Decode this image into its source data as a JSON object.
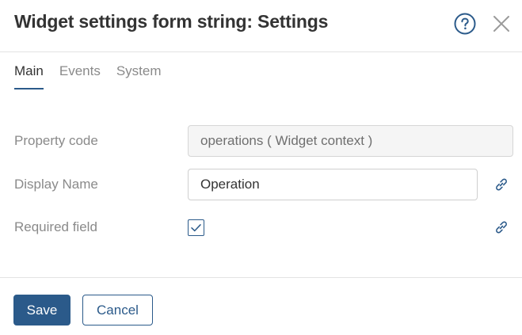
{
  "dialog": {
    "title": "Widget settings form string: Settings",
    "help_icon": "question-circle-icon",
    "close_icon": "close-icon"
  },
  "tabs": [
    {
      "label": "Main",
      "active": true
    },
    {
      "label": "Events",
      "active": false
    },
    {
      "label": "System",
      "active": false
    }
  ],
  "form": {
    "property_code": {
      "label": "Property code",
      "value": "operations ( Widget context )"
    },
    "display_name": {
      "label": "Display Name",
      "value": "Operation",
      "link_icon": "link-icon"
    },
    "required_field": {
      "label": "Required field",
      "checked": true,
      "link_icon": "link-icon"
    }
  },
  "footer": {
    "save_label": "Save",
    "cancel_label": "Cancel"
  },
  "colors": {
    "accent": "#2b5a8a",
    "text": "#333333",
    "muted": "#8a8a8a",
    "border": "#cfcfcf",
    "readonly_bg": "#f5f5f5"
  }
}
